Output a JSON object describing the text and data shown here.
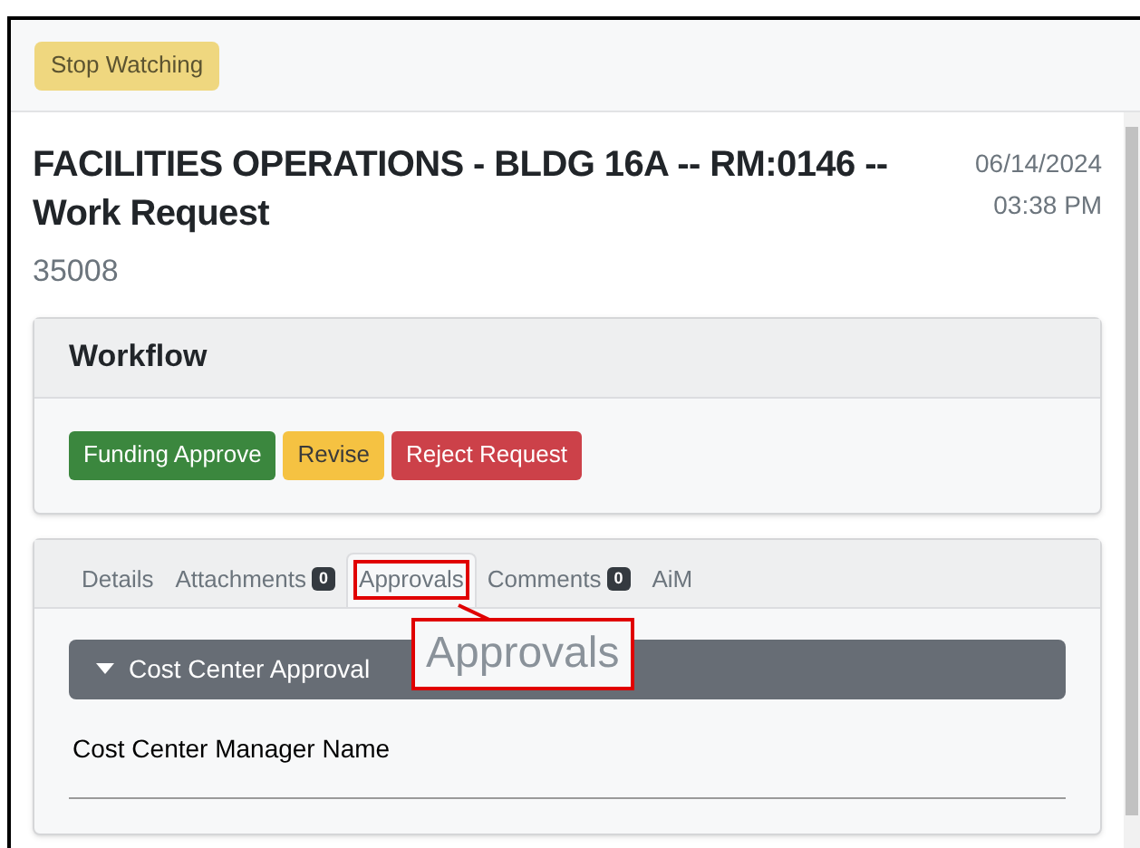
{
  "toolbar": {
    "watch_button": "Stop Watching"
  },
  "request": {
    "title": "FACILITIES OPERATIONS - BLDG 16A -- RM:0146 -- Work Request",
    "number": "35008",
    "date": "06/14/2024",
    "time": "03:38 PM"
  },
  "workflow": {
    "title": "Workflow",
    "buttons": [
      {
        "label": "Funding Approve",
        "kind": "success"
      },
      {
        "label": "Revise",
        "kind": "warning"
      },
      {
        "label": "Reject Request",
        "kind": "danger"
      }
    ]
  },
  "tabs": [
    {
      "label": "Details",
      "selected": false
    },
    {
      "label": "Attachments",
      "badge": "0",
      "selected": false
    },
    {
      "label": "Approvals",
      "selected": true
    },
    {
      "label": "Comments",
      "badge": "0",
      "selected": false
    },
    {
      "label": "AiM",
      "selected": false
    }
  ],
  "approval_section": {
    "title": "Cost Center Approval",
    "expanded": true,
    "field_label": "Cost Center Manager Name"
  },
  "callout": {
    "text": "Approvals"
  }
}
